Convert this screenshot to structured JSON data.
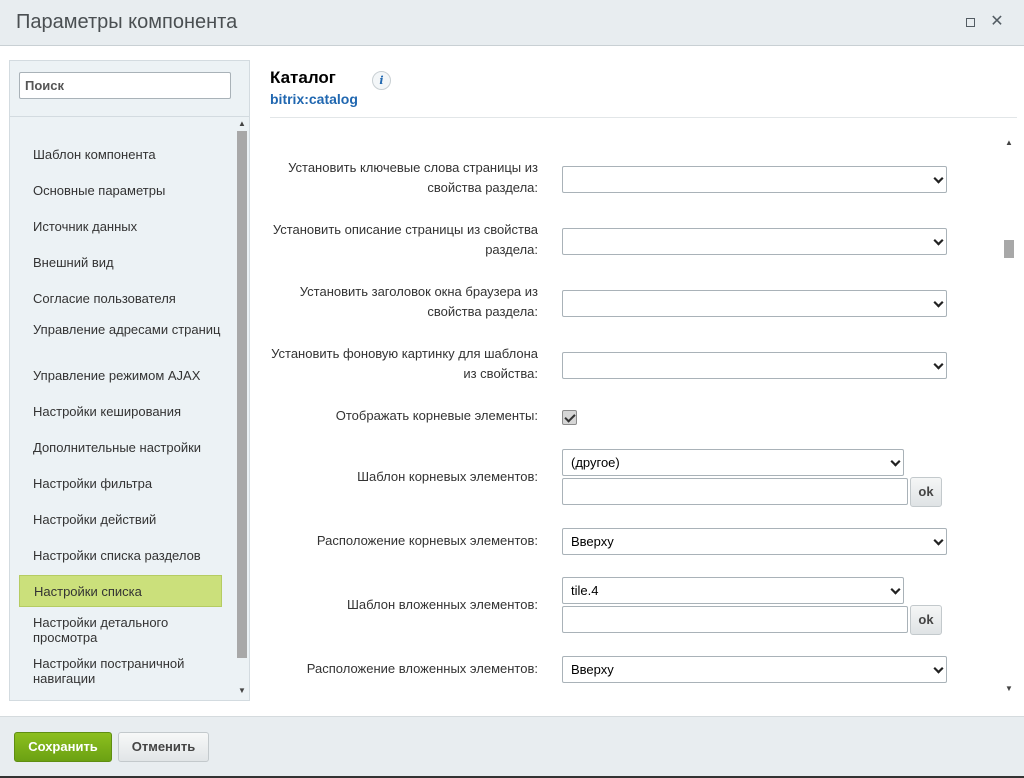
{
  "window": {
    "title": "Параметры компонента"
  },
  "sidebar": {
    "search_placeholder": "Поиск",
    "items": [
      {
        "label": "Шаблон компонента",
        "active": false
      },
      {
        "label": "Основные параметры",
        "active": false
      },
      {
        "label": "Источник данных",
        "active": false
      },
      {
        "label": "Внешний вид",
        "active": false
      },
      {
        "label": "Согласие пользователя",
        "active": false
      },
      {
        "label": "Управление адресами страниц",
        "active": false
      },
      {
        "label": "Управление режимом AJAX",
        "active": false
      },
      {
        "label": "Настройки кеширования",
        "active": false
      },
      {
        "label": "Дополнительные настройки",
        "active": false
      },
      {
        "label": "Настройки фильтра",
        "active": false
      },
      {
        "label": "Настройки действий",
        "active": false
      },
      {
        "label": "Настройки списка разделов",
        "active": false
      },
      {
        "label": "Настройки списка",
        "active": true
      },
      {
        "label": "Настройки детального просмотра",
        "active": false
      },
      {
        "label": "Настройки постраничной навигации",
        "active": false
      }
    ]
  },
  "component": {
    "title": "Каталог",
    "code": "bitrix:catalog",
    "info_icon": "i"
  },
  "form": {
    "fields": [
      {
        "label": "Установить ключевые слова страницы из свойства раздела:",
        "type": "select",
        "value": ""
      },
      {
        "label": "Установить описание страницы из свойства раздела:",
        "type": "select",
        "value": ""
      },
      {
        "label": "Установить заголовок окна браузера из свойства раздела:",
        "type": "select",
        "value": ""
      },
      {
        "label": "Установить фоновую картинку для шаблона из свойства:",
        "type": "select",
        "value": ""
      },
      {
        "label": "Отображать корневые элементы:",
        "type": "checkbox",
        "checked": true
      },
      {
        "label": "Шаблон корневых элементов:",
        "type": "select+text",
        "value": "(другое)",
        "text": "",
        "ok": "ok"
      },
      {
        "label": "Расположение корневых элементов:",
        "type": "select",
        "value": "Вверху"
      },
      {
        "label": "Шаблон вложенных элементов:",
        "type": "select+text",
        "value": "tile.4",
        "text": "",
        "ok": "ok"
      },
      {
        "label": "Расположение вложенных элементов:",
        "type": "select",
        "value": "Вверху"
      }
    ]
  },
  "footer": {
    "save_label": "Сохранить",
    "cancel_label": "Отменить"
  }
}
